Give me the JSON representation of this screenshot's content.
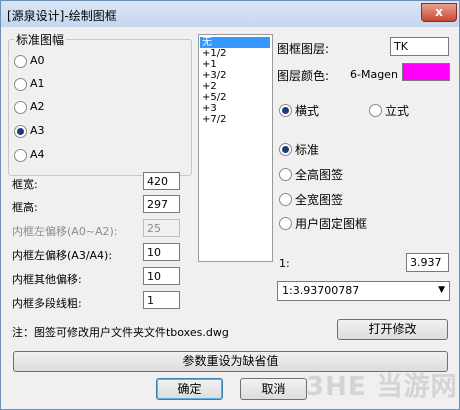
{
  "window": {
    "title": "[源泉设计]-绘制图框",
    "close_label": "x"
  },
  "paper_group": {
    "label": "标准图幅",
    "options": [
      "A0",
      "A1",
      "A2",
      "A3",
      "A4"
    ],
    "selected": "A3"
  },
  "fields": {
    "width": {
      "label": "框宽:",
      "value": "420"
    },
    "height": {
      "label": "框高:",
      "value": "297"
    },
    "offset_a0a2": {
      "label": "内框左偏移(A0~A2):",
      "value": "25"
    },
    "offset_a3a4": {
      "label": "内框左偏移(A3/A4):",
      "value": "10"
    },
    "offset_other": {
      "label": "内框其他偏移:",
      "value": "10"
    },
    "polyline_width": {
      "label": "内框多段线粗:",
      "value": "1"
    }
  },
  "enlarge_list": {
    "items": [
      "无",
      "+1/2",
      "+1",
      "+3/2",
      "+2",
      "+5/2",
      "+3",
      "+7/2"
    ],
    "selected": "无"
  },
  "layer": {
    "label": "图框图层:",
    "value": "TK"
  },
  "layer_color": {
    "label": "图层颜色:",
    "value": "6-Magen",
    "swatch": "#ff00ff"
  },
  "orientation": {
    "options": [
      "横式",
      "立式"
    ],
    "selected": "横式"
  },
  "title_block": {
    "options": [
      "标准",
      "全高图签",
      "全宽图签",
      "用户固定图框"
    ],
    "selected": "标准"
  },
  "scale": {
    "label": "1:",
    "value": "3.937",
    "dropdown_value": "1:3.93700787"
  },
  "note": "注：图签可修改用户文件夹文件tboxes.dwg",
  "buttons": {
    "open_edit": "打开修改",
    "reset": "参数重设为缺省值",
    "ok": "确定",
    "cancel": "取消"
  },
  "watermark": "3HE 当游网"
}
